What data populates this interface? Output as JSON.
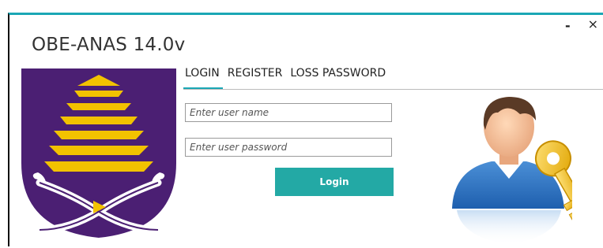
{
  "window": {
    "title": "OBE-ANAS 14.0v",
    "minimize_label": "-",
    "close_label": "×"
  },
  "tabs": [
    {
      "label": "LOGIN",
      "active": true
    },
    {
      "label": "REGISTER",
      "active": false
    },
    {
      "label": "LOSS PASSWORD",
      "active": false
    }
  ],
  "form": {
    "username_placeholder": "Enter user name",
    "password_placeholder": "Enter user password",
    "username_value": "",
    "password_value": "",
    "login_label": "Login"
  },
  "icons": {
    "logo": "university-crest-logo",
    "user_key": "user-with-key-icon"
  },
  "colors": {
    "accent": "#1aa7b5",
    "button": "#23a9a5",
    "logo_purple": "#4b1f73",
    "logo_gold": "#f2c200"
  }
}
